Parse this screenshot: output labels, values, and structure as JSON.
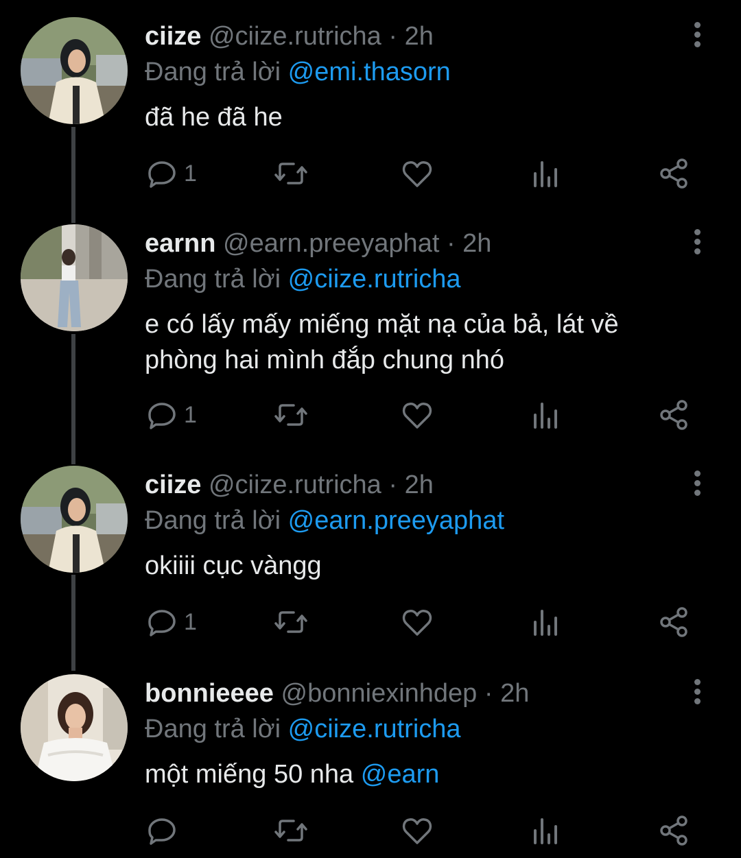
{
  "reply_prefix": "Đang trả lời",
  "separator": "·",
  "tweets": [
    {
      "name": "ciize",
      "handle": "@ciize.rutricha",
      "time": "2h",
      "replying_to": "@emi.thasorn",
      "text": "đã he đã he",
      "mention": "",
      "reply_count": "1"
    },
    {
      "name": "earnn",
      "handle": "@earn.preeyaphat",
      "time": "2h",
      "replying_to": "@ciize.rutricha",
      "text": "e có lấy mấy miếng mặt nạ của bả, lát về phòng hai mình đắp chung nhó",
      "mention": "",
      "reply_count": "1"
    },
    {
      "name": "ciize",
      "handle": "@ciize.rutricha",
      "time": "2h",
      "replying_to": "@earn.preeyaphat",
      "text": "okiiii cục vàngg",
      "mention": "",
      "reply_count": "1"
    },
    {
      "name": "bonnieeee",
      "handle": "@bonniexinhdep",
      "time": "2h",
      "replying_to": "@ciize.rutricha",
      "text": "một miếng 50 nha ",
      "mention": "@earn",
      "reply_count": ""
    }
  ],
  "icons": [
    "reply-icon",
    "retweet-icon",
    "like-icon",
    "views-icon",
    "share-icon",
    "more-icon"
  ],
  "colors": {
    "background": "#000000",
    "text": "#e7e9ea",
    "muted": "#71767b",
    "link": "#1d9bf0",
    "thread_line": "#3e4144"
  }
}
